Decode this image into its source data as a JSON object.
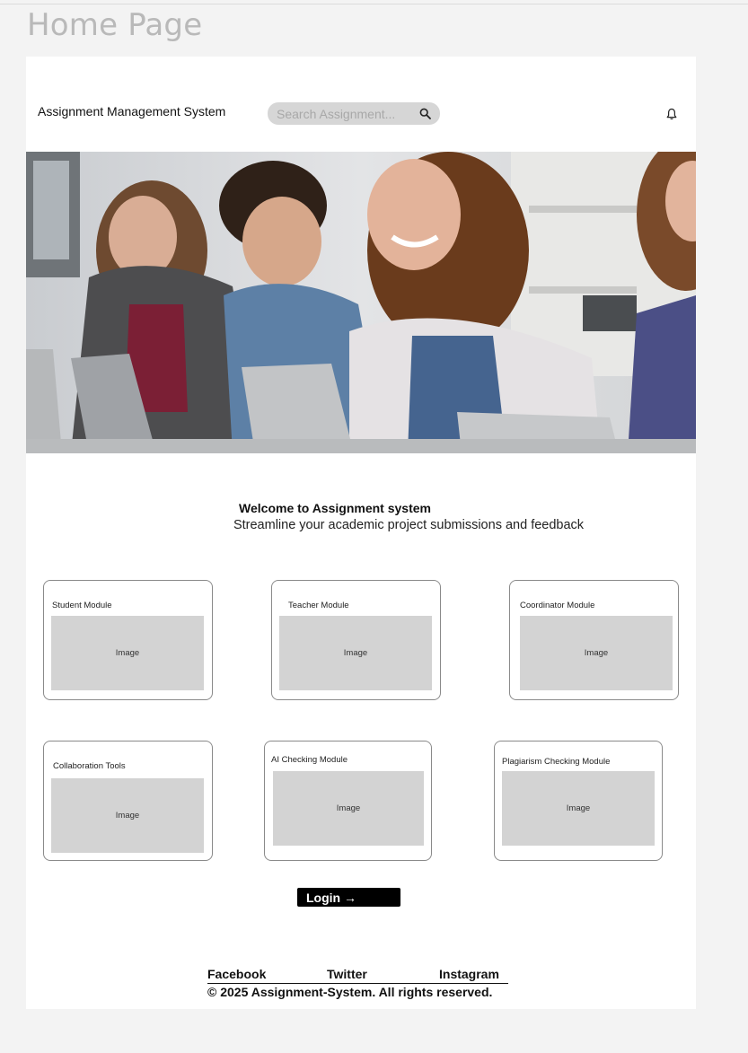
{
  "frame_title": "Home Page",
  "header": {
    "app_title": "Assignment Management System",
    "search_placeholder": "Search Assignment...",
    "search_icon": "search-icon",
    "notification_icon": "bell-icon"
  },
  "welcome": {
    "title": "Welcome to Assignment system",
    "subtitle": "Streamline your academic project submissions and feedback"
  },
  "modules": [
    {
      "label": "Student Module",
      "image_text": "Image"
    },
    {
      "label": "Teacher Module",
      "image_text": "Image"
    },
    {
      "label": "Coordinator Module",
      "image_text": "Image"
    },
    {
      "label": "Collaboration Tools",
      "image_text": "Image"
    },
    {
      "label": "AI Checking Module",
      "image_text": "Image"
    },
    {
      "label": "Plagiarism Checking Module",
      "image_text": "Image"
    }
  ],
  "login_button": "Login →",
  "footer": {
    "links": [
      "Facebook",
      "Twitter",
      "Instagram"
    ],
    "copyright": "© 2025 Assignment-System. All rights reserved."
  },
  "colors": {
    "page_background": "#f3f3f3",
    "frame_background": "#ffffff",
    "search_background": "#d6d6d6",
    "placeholder_gray": "#d3d3d3",
    "button_black": "#000000"
  }
}
